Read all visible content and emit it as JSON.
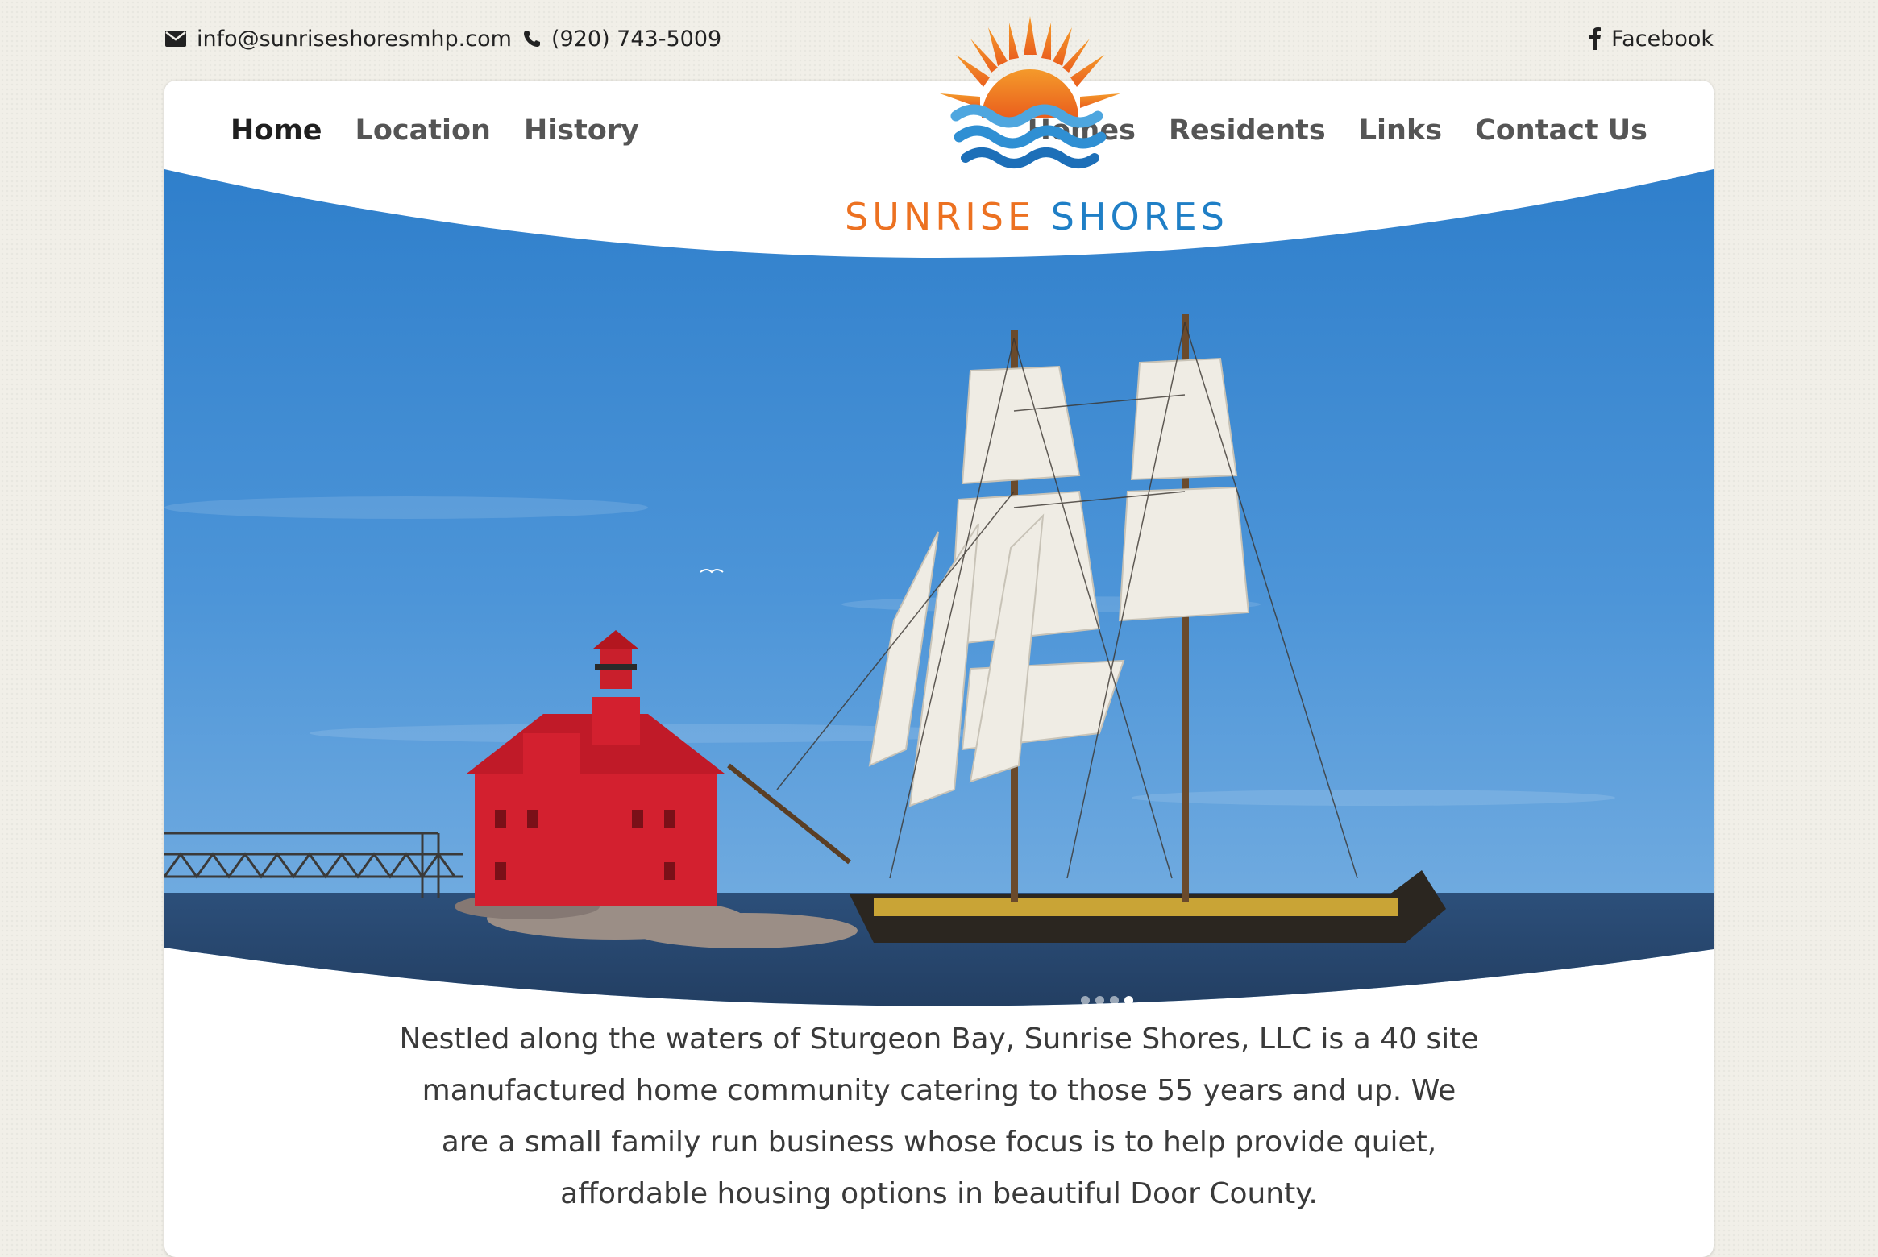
{
  "topbar": {
    "email": "info@sunriseshoresmhp.com",
    "phone": "(920) 743-5009",
    "facebook": "Facebook"
  },
  "nav": {
    "left": [
      "Home",
      "Location",
      "History"
    ],
    "right": [
      "Homes",
      "Residents",
      "Links",
      "Contact Us"
    ],
    "active": "Home"
  },
  "logo": {
    "word1": "SUNRISE",
    "word2": "SHORES"
  },
  "slider": {
    "slide_count": 4,
    "active_slide": 4
  },
  "intro": {
    "text": "Nestled along the waters of Sturgeon Bay, Sunrise Shores, LLC is a 40 site manufactured home community catering to those 55 years and up. We are a small family run business whose focus is to help provide quiet, affordable housing options in beautiful Door County."
  },
  "colors": {
    "orange": "#ec7121",
    "blue": "#1f7fc6",
    "background": "#f1efe8"
  }
}
